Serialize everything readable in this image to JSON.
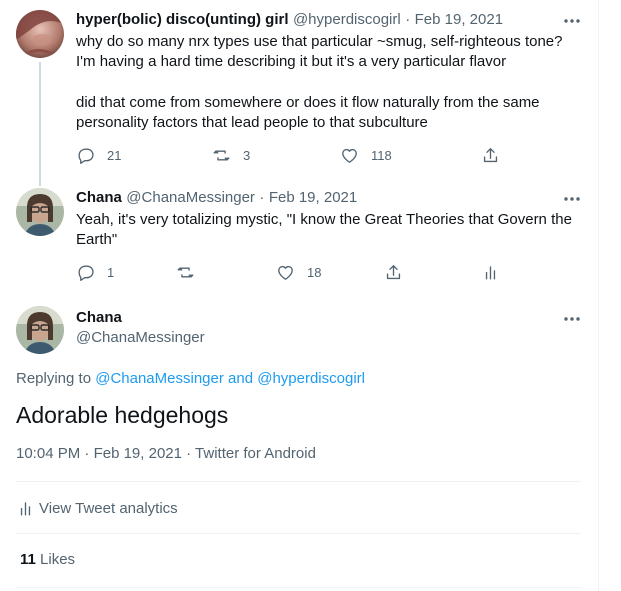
{
  "tweet1": {
    "name": "hyper(bolic) disco(unting) girl",
    "handle": "@hyperdiscogirl",
    "sep": "·",
    "date": "Feb 19, 2021",
    "line1": "why do so many nrx types use that particular ~smug, self-righteous tone?",
    "line2": "I'm having a hard time describing it but it's a very particular flavor",
    "line3": "did that come from somewhere or does it flow naturally from the same",
    "line4": "personality factors that lead people to that subculture",
    "replies": "21",
    "retweets": "3",
    "likes": "118"
  },
  "tweet2": {
    "name": "Chana",
    "handle": "@ChanaMessinger",
    "sep": "·",
    "date": "Feb 19, 2021",
    "line1": "Yeah, it's very totalizing mystic, \"I know the Great Theories that Govern the",
    "line2": "Earth\"",
    "replies": "1",
    "likes": "18"
  },
  "main": {
    "name": "Chana",
    "handle": "@ChanaMessinger",
    "replying_prefix": "Replying to",
    "replying_user1": "@ChanaMessinger",
    "replying_and": "and",
    "replying_user2": "@hyperdiscogirl",
    "body": "Adorable hedgehogs",
    "time": "10:04 PM",
    "sep": "·",
    "date": "Feb 19, 2021",
    "source": "Twitter for Android",
    "analytics_label": "View Tweet analytics",
    "likes_count": "11",
    "likes_label": "Likes"
  },
  "colors": {
    "accent": "#1d9bf0",
    "secondary_text": "#536471",
    "primary_text": "#0f1419",
    "divider": "#eff3f4"
  },
  "icons": [
    "more-icon",
    "reply-icon",
    "retweet-icon",
    "like-icon",
    "share-icon",
    "analytics-icon"
  ]
}
